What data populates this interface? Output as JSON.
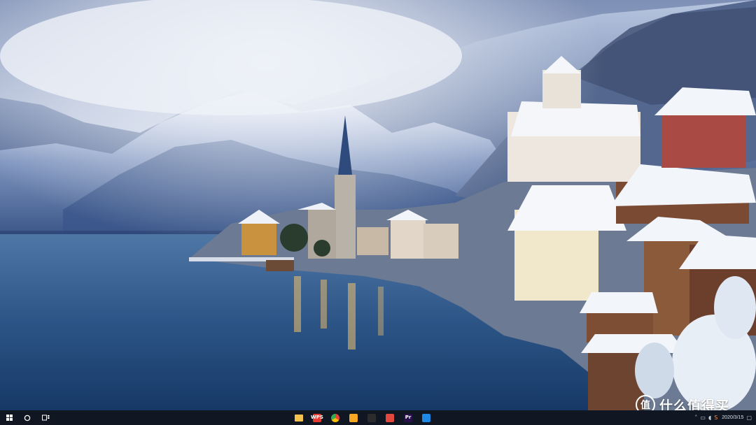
{
  "desktop": {
    "wallpaper_subject": "snowy-lakeside-alpine-village"
  },
  "taskbar": {
    "start_icon": "windows-logo-icon",
    "search_icon": "cortana-circle-icon",
    "task_view_icon": "task-view-icon",
    "pinned_apps": [
      {
        "id": "file-explorer",
        "icon": "folder-icon",
        "color": "#f2c14e",
        "running": false
      },
      {
        "id": "wps",
        "label": "WPS",
        "icon": "wps-icon",
        "color": "#e53b30",
        "running": false
      },
      {
        "id": "chrome",
        "icon": "chrome-icon",
        "color": "#4285f4",
        "running": false
      },
      {
        "id": "photo-app",
        "icon": "photo-icon",
        "color": "#f5a623",
        "running": false
      },
      {
        "id": "media-app",
        "icon": "dash-icon",
        "color": "#2c2c2c",
        "running": false
      },
      {
        "id": "app-red",
        "icon": "red-square-icon",
        "color": "#e2483d",
        "running": false
      },
      {
        "id": "premiere",
        "label": "Pr",
        "icon": "premiere-icon",
        "color": "#2a0f4d",
        "running": false
      },
      {
        "id": "app-blue",
        "icon": "blue-pin-icon",
        "color": "#1e88e5",
        "running": false
      }
    ],
    "clock": {
      "time": "",
      "date": "2020/3/15"
    }
  },
  "watermark": {
    "symbol": "值",
    "text": "什么值得买"
  }
}
